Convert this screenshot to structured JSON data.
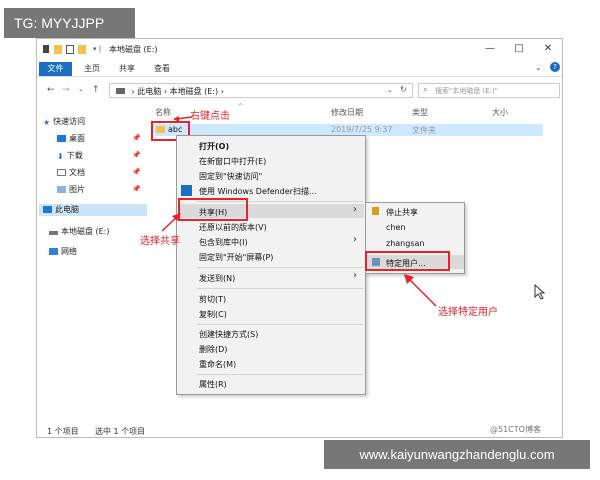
{
  "watermark_top": "TG: MYYJJPP",
  "watermark_bottom": "www.kaiyunwangzhandenglu.com",
  "credit": "@51CTO博客",
  "window": {
    "title": "本地磁盘 (E:)",
    "controls": {
      "minimize": "—",
      "maximize": "□",
      "close": "✕"
    }
  },
  "ribbon": {
    "tabs": [
      "文件",
      "主页",
      "共享",
      "查看"
    ],
    "help": "?"
  },
  "address": {
    "path": [
      "此电脑",
      "本地磁盘 (E:)"
    ],
    "search_placeholder": "搜索\"本地磁盘 (E:)\""
  },
  "nav_pane": {
    "quick_access": "快速访问",
    "items": [
      "桌面",
      "下载",
      "文档",
      "图片"
    ],
    "this_pc": "此电脑",
    "drive": "本地磁盘 (E:)",
    "network": "网络"
  },
  "columns": {
    "name": "名称",
    "date": "修改日期",
    "type": "类型",
    "size": "大小"
  },
  "file": {
    "name": "abc",
    "date": "2019/7/25 9:37",
    "type": "文件夹"
  },
  "status": {
    "count": "1 个项目",
    "selected": "选中 1 个项目"
  },
  "context_menu": {
    "group1": [
      "打开(O)",
      "在新窗口中打开(E)",
      "固定到\"快速访问\"",
      "使用 Windows Defender扫描..."
    ],
    "group2": [
      "共享(H)",
      "还原以前的版本(V)",
      "包含到库中(I)",
      "固定到\"开始\"屏幕(P)"
    ],
    "group3": [
      "发送到(N)"
    ],
    "group4": [
      "剪切(T)",
      "复制(C)"
    ],
    "group5": [
      "创建快捷方式(S)",
      "删除(D)",
      "重命名(M)"
    ],
    "group6": [
      "属性(R)"
    ]
  },
  "share_submenu": {
    "items": [
      "停止共享",
      "chen",
      "zhangsan",
      "特定用户..."
    ]
  },
  "annotations": {
    "right_click": "右键点击",
    "choose_share": "选择共享",
    "choose_user": "选择特定用户"
  },
  "colors": {
    "accent": "#1a6fc3",
    "annotation": "#e8222a",
    "selection": "#cde8ff"
  }
}
